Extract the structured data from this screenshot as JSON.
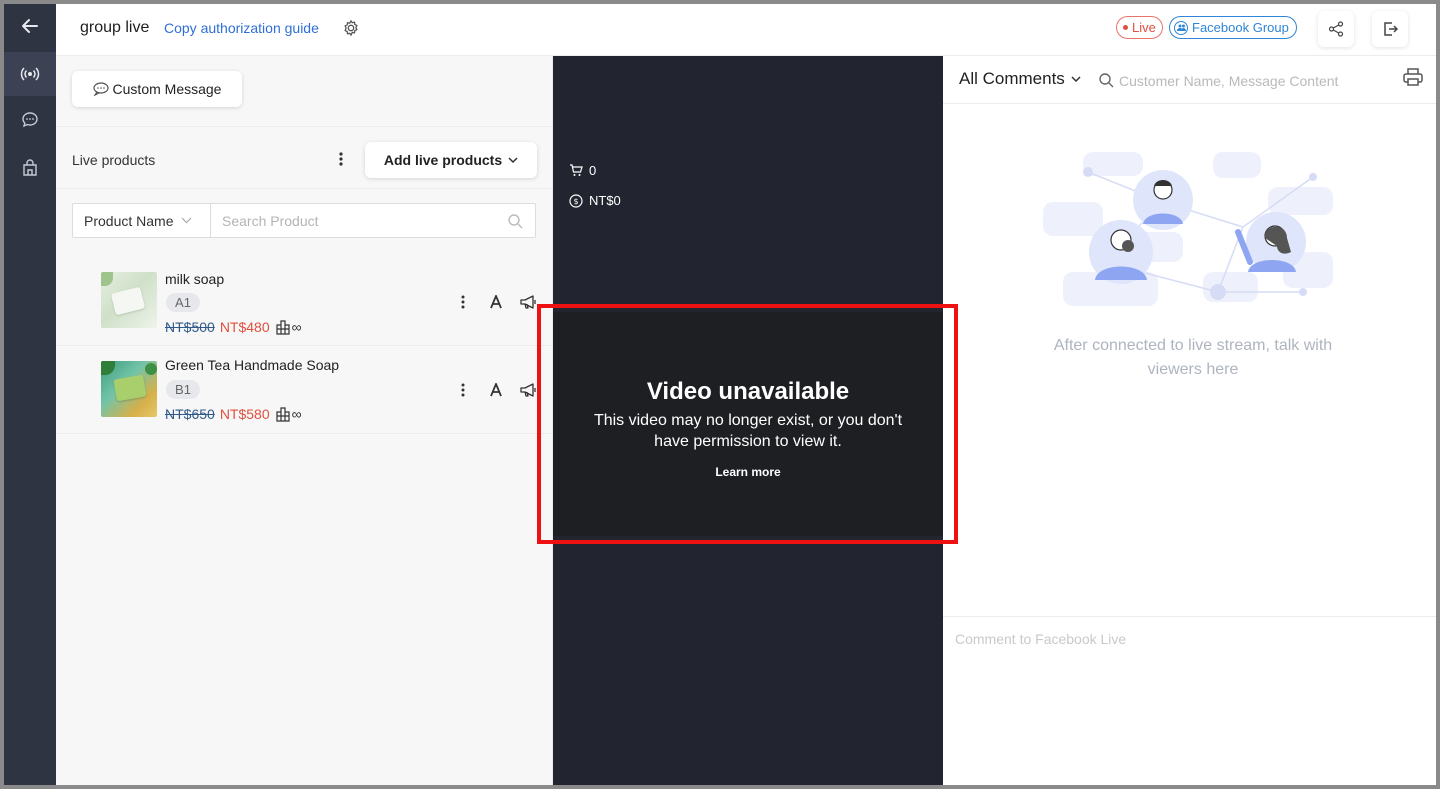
{
  "header": {
    "title": "group live",
    "guide_link": "Copy authorization guide",
    "live_badge": "Live",
    "platform_badge": "Facebook Group"
  },
  "rail": {
    "icons": [
      "back-arrow-icon",
      "live-broadcast-icon",
      "chat-icon",
      "shop-icon"
    ]
  },
  "products_panel": {
    "custom_message": "Custom Message",
    "section_label": "Live products",
    "add_button": "Add live products",
    "filter_select": "Product Name",
    "search_placeholder": "Search Product",
    "items": [
      {
        "name": "milk soap",
        "code": "A1",
        "original_price": "NT$500",
        "sale_price": "NT$480",
        "stock": "∞"
      },
      {
        "name": "Green Tea Handmade Soap",
        "code": "B1",
        "original_price": "NT$650",
        "sale_price": "NT$580",
        "stock": "∞"
      }
    ]
  },
  "video_panel": {
    "cart_count": "0",
    "revenue": "NT$0",
    "title": "Video unavailable",
    "message": "This video may no longer exist, or you don't have permission to view it.",
    "learn_more": "Learn more"
  },
  "comments_panel": {
    "filter": "All Comments",
    "search_placeholder": "Customer Name, Message Content",
    "empty_text": "After connected to live stream, talk with viewers here",
    "input_placeholder": "Comment to Facebook Live"
  },
  "colors": {
    "rail_bg": "#2f3442",
    "video_bg": "#22252f",
    "live_red": "#e0503f",
    "facebook_blue": "#2f86d6",
    "link_blue": "#2f6fd6",
    "highlight_outline": "#ee1111"
  }
}
